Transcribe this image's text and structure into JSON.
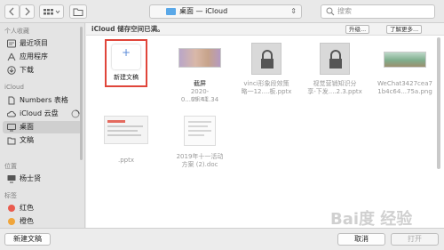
{
  "toolbar": {
    "location": "桌面 — iCloud",
    "search_placeholder": "搜索"
  },
  "sidebar": {
    "sections": [
      {
        "title": "个人收藏"
      },
      {
        "title": "iCloud"
      },
      {
        "title": "位置"
      },
      {
        "title": "标签"
      }
    ],
    "favorites": [
      "最近项目",
      "应用程序",
      "下载"
    ],
    "icloud": [
      "Numbers 表格",
      "iCloud 云盘",
      "桌面",
      "文稿"
    ],
    "locations": [
      "杨士贤"
    ],
    "tags": [
      {
        "label": "红色",
        "color": "#e95b4e"
      },
      {
        "label": "橙色",
        "color": "#f0a53a"
      }
    ]
  },
  "icloud_bar": {
    "message": "iCloud 储存空间已满。",
    "upgrade": "升级...",
    "learn_more": "了解更多..."
  },
  "files": [
    {
      "name": "新建文稿",
      "sub": ""
    },
    {
      "name": "截屏",
      "line2": "2020-0...09.41.34",
      "sub": "空间不足"
    },
    {
      "name": "vinci形象段效策",
      "line2": "略一12....板.pptx"
    },
    {
      "name": "视觉营销知识分",
      "line2": "享-下发....2.3.pptx"
    },
    {
      "name": "WeChat3427cea7",
      "line2": "1b4c64...75a.png"
    },
    {
      "name": ".pptx",
      "line2": ""
    },
    {
      "name": "2019年十一活动",
      "line2": "方案 (2).doc"
    }
  ],
  "bottom": {
    "new_doc": "新建文稿",
    "cancel": "取消",
    "open": "打开"
  },
  "watermark": "Bai度 经验"
}
